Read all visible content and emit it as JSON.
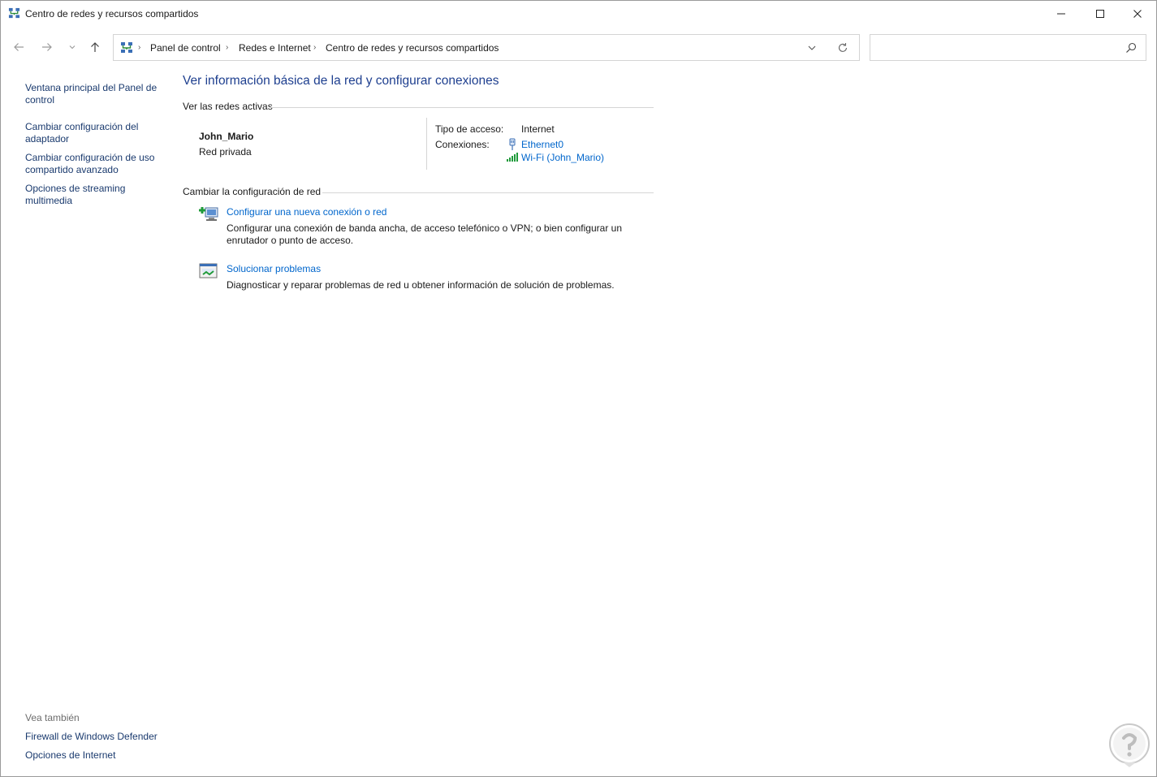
{
  "window": {
    "title": "Centro de redes y recursos compartidos"
  },
  "address_bar": {
    "breadcrumbs": [
      "Panel de control",
      "Redes e Internet",
      "Centro de redes y recursos compartidos"
    ],
    "search_placeholder": ""
  },
  "left_pane": {
    "links": [
      "Ventana principal del Panel de control",
      "Cambiar configuración del adaptador",
      "Cambiar configuración de uso compartido avanzado",
      "Opciones de streaming multimedia"
    ],
    "see_also_label": "Vea también",
    "see_also": [
      "Firewall de Windows Defender",
      "Opciones de Internet"
    ]
  },
  "main": {
    "heading": "Ver información básica de la red y configurar conexiones",
    "active_networks_label": "Ver las redes activas",
    "network": {
      "name": "John_Mario",
      "category": "Red privada",
      "access_type_label": "Tipo de acceso:",
      "access_type_value": "Internet",
      "connections_label": "Conexiones:",
      "connections": [
        "Ethernet0",
        "Wi-Fi (John_Mario)"
      ]
    },
    "change_settings_label": "Cambiar la configuración de red",
    "tasks": [
      {
        "title": "Configurar una nueva conexión o red",
        "description": "Configurar una conexión de banda ancha, de acceso telefónico o VPN; o bien configurar un enrutador o punto de acceso."
      },
      {
        "title": "Solucionar problemas",
        "description": "Diagnosticar y reparar problemas de red u obtener información de solución de problemas."
      }
    ]
  },
  "colors": {
    "link": "#0066cc",
    "heading": "#1e3f8f",
    "left_link": "#1a3a6e"
  }
}
